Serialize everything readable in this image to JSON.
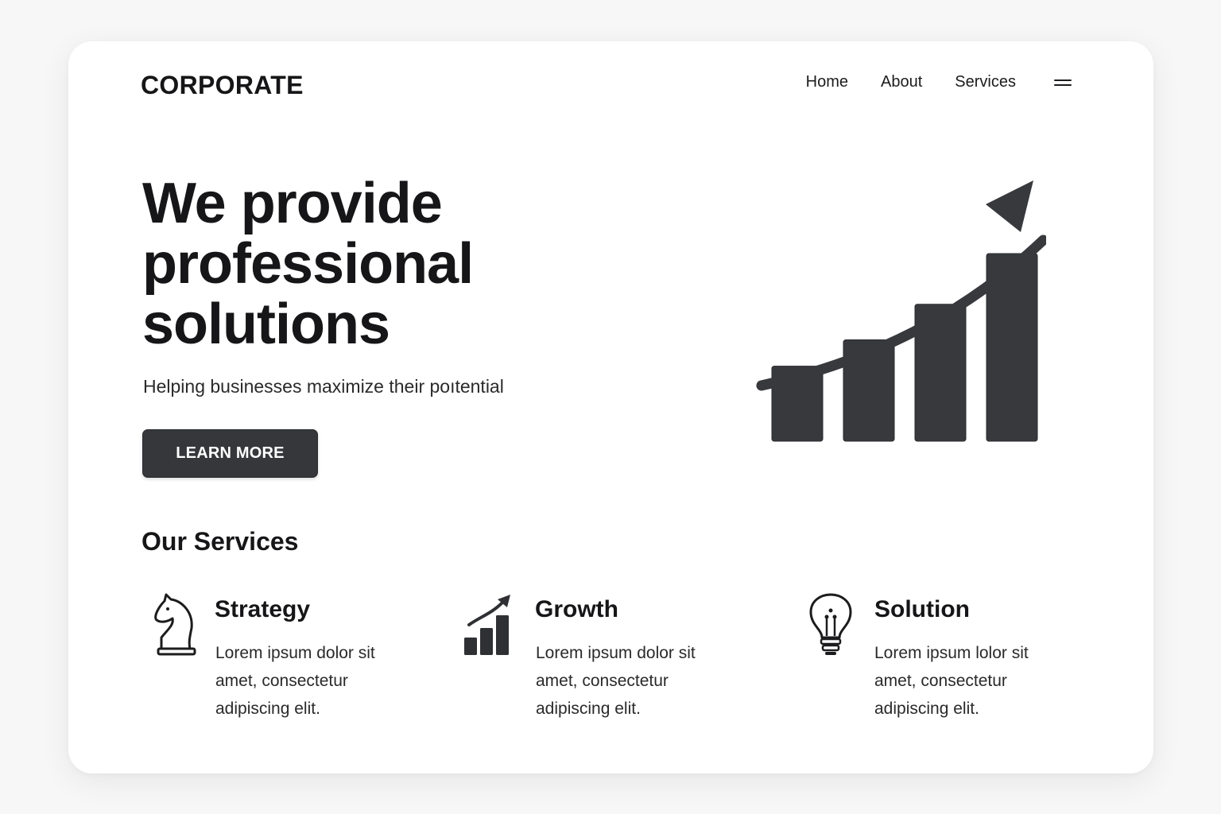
{
  "brand": {
    "logo": "CORPORATE"
  },
  "nav": {
    "items": [
      {
        "label": "Home"
      },
      {
        "label": "About"
      },
      {
        "label": "Services"
      }
    ],
    "menu_icon": "hamburger-menu-icon"
  },
  "hero": {
    "title_lines": [
      "We provide",
      "professional",
      "solutions"
    ],
    "subtitle": "Helping businesses maximize their poıtential",
    "cta_label": "LEARN MORE",
    "illustration": "growth-bar-chart-icon",
    "illustration_bar_levels": [
      0.4,
      0.54,
      0.73,
      1.0
    ]
  },
  "services": {
    "heading": "Our Services",
    "items": [
      {
        "icon": "chess-knight-icon",
        "name": "Strategy",
        "desc": "Lorem ipsum dolor sit amet, consectetur adipiscing elit."
      },
      {
        "icon": "growth-chart-icon",
        "name": "Growth",
        "desc": "Lorem ipsum dolor sit amet, consectetur adipiscing elit."
      },
      {
        "icon": "lightbulb-icon",
        "name": "Solution",
        "desc": "Lorem ipsum lolor sit amet, consectetur adipiscing elit."
      }
    ]
  },
  "colors": {
    "background": "#f7f7f7",
    "card": "#ffffff",
    "text": "#161618",
    "button": "#36373b",
    "illustration": "#38393d"
  }
}
